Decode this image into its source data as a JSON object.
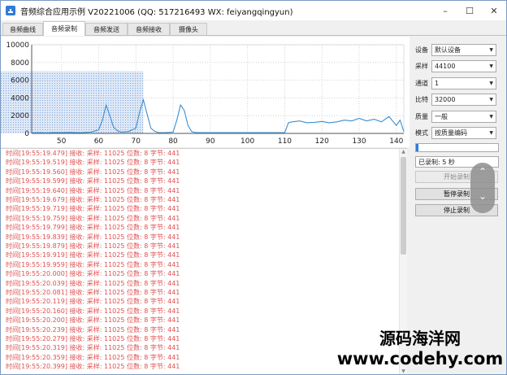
{
  "window": {
    "title": "音频综合应用示例 V20221006 (QQ: 517216493 WX: feiyangqingyun)",
    "controls": [
      "–",
      "☐",
      "✕"
    ]
  },
  "tabs": [
    {
      "label": "音频曲线",
      "active": false
    },
    {
      "label": "音频录制",
      "active": true
    },
    {
      "label": "音频发送",
      "active": false
    },
    {
      "label": "音频接收",
      "active": false
    },
    {
      "label": "摄像头",
      "active": false
    }
  ],
  "chart_data": {
    "type": "line",
    "y_ticks": [
      "10000",
      "8000",
      "6000",
      "4000",
      "2000",
      "0"
    ],
    "x_ticks": [
      "50",
      "60",
      "70",
      "80",
      "90",
      "100",
      "110",
      "120",
      "130",
      "140"
    ],
    "xlim": [
      42,
      142
    ],
    "ylim": [
      0,
      10000
    ],
    "color": "#3c8fd0",
    "selection": {
      "x": [
        42,
        72
      ],
      "y": [
        0,
        7000
      ]
    },
    "x": [
      42,
      44,
      46,
      48,
      50,
      52,
      54,
      56,
      58,
      60,
      61,
      62,
      63,
      64,
      65,
      66,
      68,
      70,
      71,
      72,
      73,
      74,
      75,
      76,
      78,
      80,
      81,
      82,
      83,
      84,
      85,
      86,
      88,
      90,
      92,
      94,
      96,
      98,
      100,
      102,
      104,
      106,
      108,
      110,
      111,
      112,
      114,
      116,
      118,
      120,
      122,
      124,
      126,
      128,
      130,
      132,
      134,
      136,
      138,
      140,
      141,
      142
    ],
    "y": [
      60,
      80,
      60,
      100,
      80,
      120,
      80,
      100,
      160,
      400,
      1500,
      3200,
      2000,
      700,
      300,
      150,
      200,
      600,
      2400,
      3800,
      2200,
      600,
      250,
      100,
      80,
      150,
      1500,
      3200,
      2600,
      900,
      200,
      100,
      80,
      80,
      80,
      80,
      80,
      80,
      80,
      80,
      80,
      80,
      80,
      80,
      1200,
      1300,
      1400,
      1200,
      1250,
      1350,
      1200,
      1300,
      1500,
      1400,
      1700,
      1400,
      1600,
      1300,
      1900,
      900,
      1500,
      200
    ]
  },
  "log": {
    "lines": [
      "时间[19:55:19.479] 接收: 采样: 11025  位数:   8  字节: 441",
      "时间[19:55:19.519] 接收: 采样: 11025  位数:   8  字节: 441",
      "时间[19:55:19.560] 接收: 采样: 11025  位数:   8  字节: 441",
      "时间[19:55:19.599] 接收: 采样: 11025  位数:   8  字节: 441",
      "时间[19:55:19.640] 接收: 采样: 11025  位数:   8  字节: 441",
      "时间[19:55:19.679] 接收: 采样: 11025  位数:   8  字节: 441",
      "时间[19:55:19.719] 接收: 采样: 11025  位数:   8  字节: 441",
      "时间[19:55:19.759] 接收: 采样: 11025  位数:   8  字节: 441",
      "时间[19:55:19.799] 接收: 采样: 11025  位数:   8  字节: 441",
      "时间[19:55:19.839] 接收: 采样: 11025  位数:   8  字节: 441",
      "时间[19:55:19.879] 接收: 采样: 11025  位数:   8  字节: 441",
      "时间[19:55:19.919] 接收: 采样: 11025  位数:   8  字节: 441",
      "时间[19:55:19.959] 接收: 采样: 11025  位数:   8  字节: 441",
      "时间[19:55:20.000] 接收: 采样: 11025  位数:   8  字节: 441",
      "时间[19:55:20.039] 接收: 采样: 11025  位数:   8  字节: 441",
      "时间[19:55:20.081] 接收: 采样: 11025  位数:   8  字节: 441",
      "时间[19:55:20.119] 接收: 采样: 11025  位数:   8  字节: 441",
      "时间[19:55:20.160] 接收: 采样: 11025  位数:   8  字节: 441",
      "时间[19:55:20.200] 接收: 采样: 11025  位数:   8  字节: 441",
      "时间[19:55:20.239] 接收: 采样: 11025  位数:   8  字节: 441",
      "时间[19:55:20.279] 接收: 采样: 11025  位数:   8  字节: 441",
      "时间[19:55:20.319] 接收: 采样: 11025  位数:   8  字节: 441",
      "时间[19:55:20.359] 接收: 采样: 11025  位数:   8  字节: 441",
      "时间[19:55:20.399] 接收: 采样: 11025  位数:   8  字节: 441"
    ]
  },
  "panel": {
    "device_label": "设备",
    "device_value": "默认设备",
    "samplerate_label": "采样",
    "samplerate_value": "44100",
    "channel_label": "通道",
    "channel_value": "1",
    "bitrate_label": "比特",
    "bitrate_value": "32000",
    "quality_label": "质量",
    "quality_value": "一般",
    "mode_label": "模式",
    "mode_value": "按质量编码",
    "progress_fraction": 0.03,
    "elapsed_text": "已录制: 5 秒",
    "start_label": "开始录制",
    "pause_label": "暂停录制",
    "stop_label": "停止录制"
  },
  "watermark": {
    "line1": "源码海洋网",
    "line2": "www.codehy.com"
  }
}
